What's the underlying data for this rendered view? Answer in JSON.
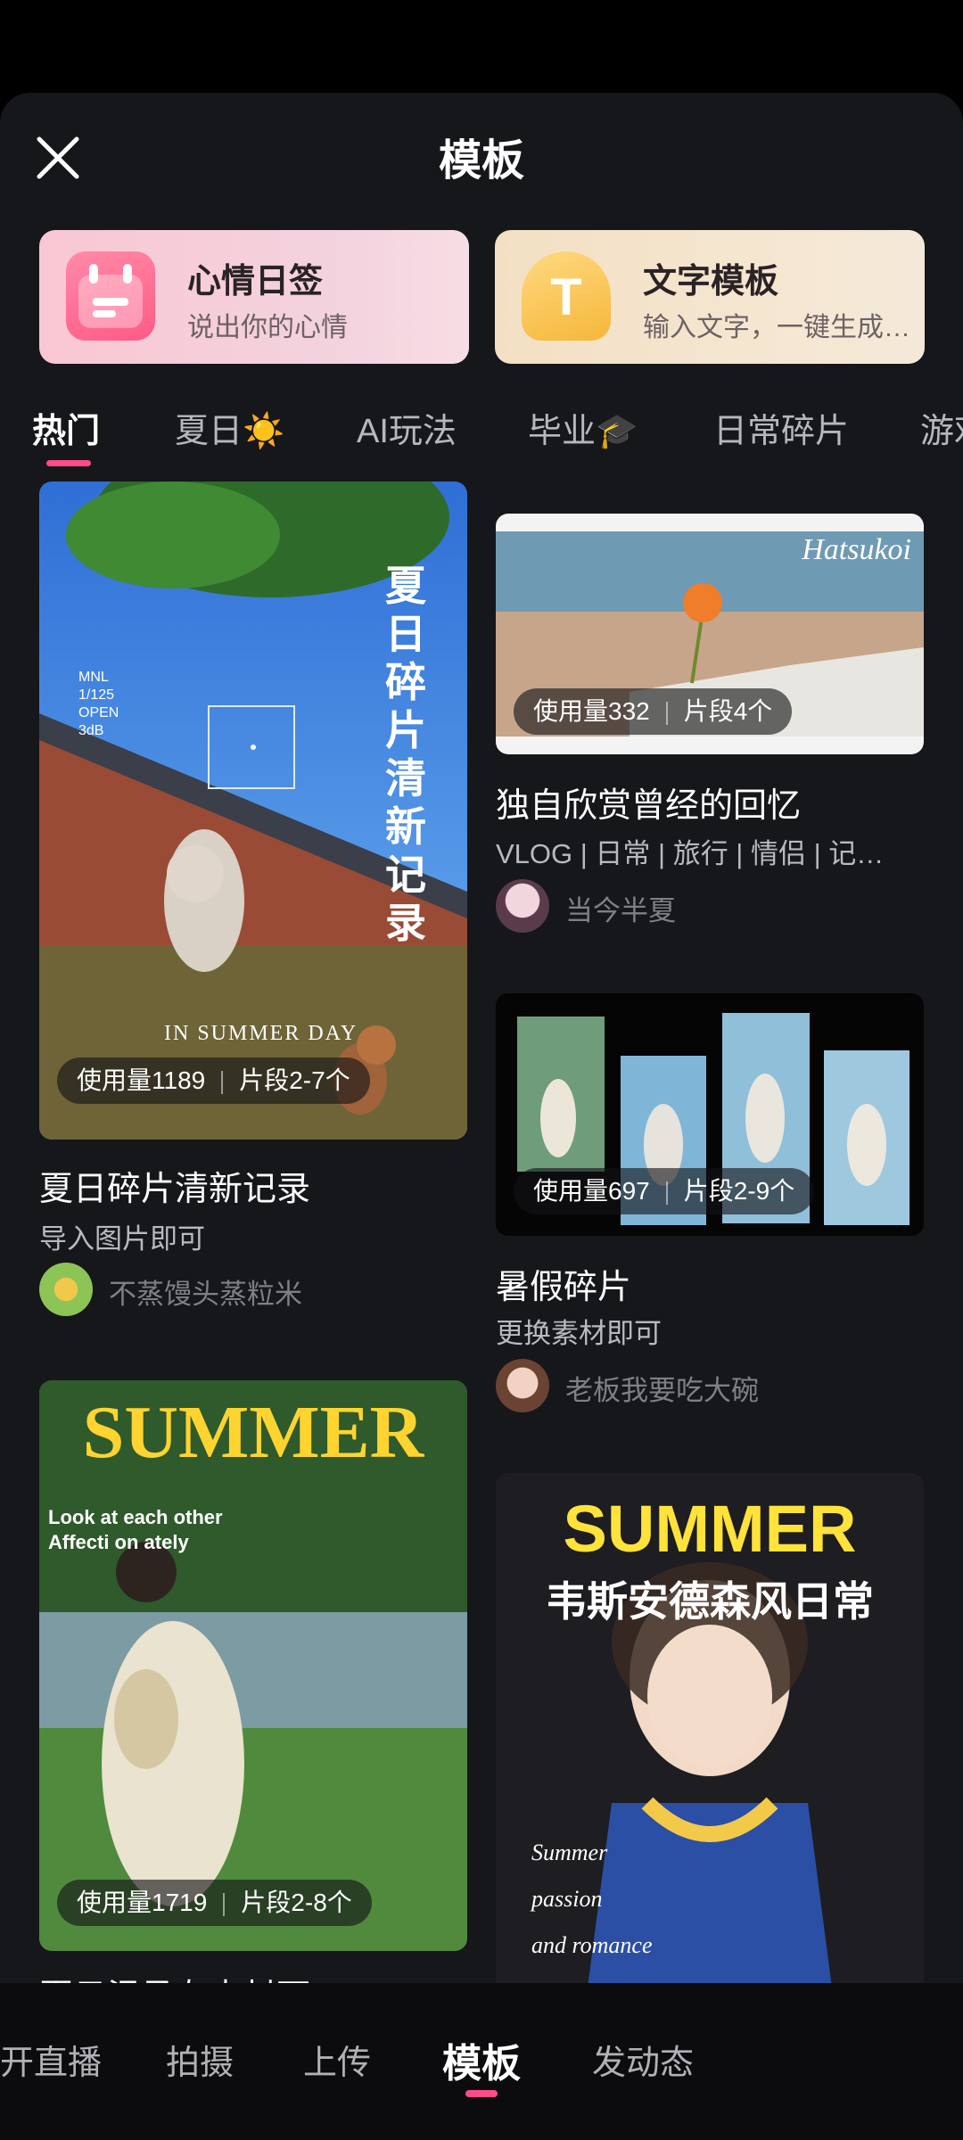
{
  "header": {
    "title": "模板"
  },
  "quick_actions": [
    {
      "title": "心情日签",
      "subtitle": "说出你的心情",
      "icon": "calendar-icon",
      "color": "#ff6b92"
    },
    {
      "title": "文字模板",
      "subtitle": "输入文字，一键生成…",
      "icon": "text-t-icon",
      "color": "#f7bc45"
    }
  ],
  "tabs": [
    "热门",
    "夏日☀️",
    "AI玩法",
    "毕业🎓",
    "日常碎片",
    "游戏"
  ],
  "cards": {
    "left": [
      {
        "poster_text": "夏日碎片清新记录",
        "camera_info": "MNL\n1/125\nOPEN\n3dB",
        "overlay_text": "IN SUMMER DAY",
        "usage": "使用量1189",
        "segments": "片段2-7个",
        "title": "夏日碎片清新记录",
        "subtitle": "导入图片即可",
        "author": "不蒸馒头蒸粒米"
      },
      {
        "poster_title": "SUMMER",
        "poster_caption": "Look at each other\nAffecti on ately",
        "usage": "使用量1719",
        "segments": "片段2-8个",
        "title": "夏日温柔杂志封面"
      }
    ],
    "right": [
      {
        "poster_brand": "Hatsukoi",
        "usage": "使用量332",
        "segments": "片段4个",
        "title": "独自欣赏曾经的回忆",
        "subtitle": "VLOG | 日常 | 旅行 | 情侣 | 记…",
        "author": "当今半夏"
      },
      {
        "usage": "使用量697",
        "segments": "片段2-9个",
        "title": "暑假碎片",
        "subtitle": "更换素材即可",
        "author": "老板我要吃大碗"
      },
      {
        "poster_title": "SUMMER",
        "poster_subtitle": "韦斯安德森风日常",
        "poster_caption": "Summer\npassion\nand romance"
      }
    ]
  },
  "bottom_nav": [
    "开直播",
    "拍摄",
    "上传",
    "模板",
    "发动态"
  ],
  "colors": {
    "accent": "#ff4b87",
    "sheet": "#16171b"
  }
}
